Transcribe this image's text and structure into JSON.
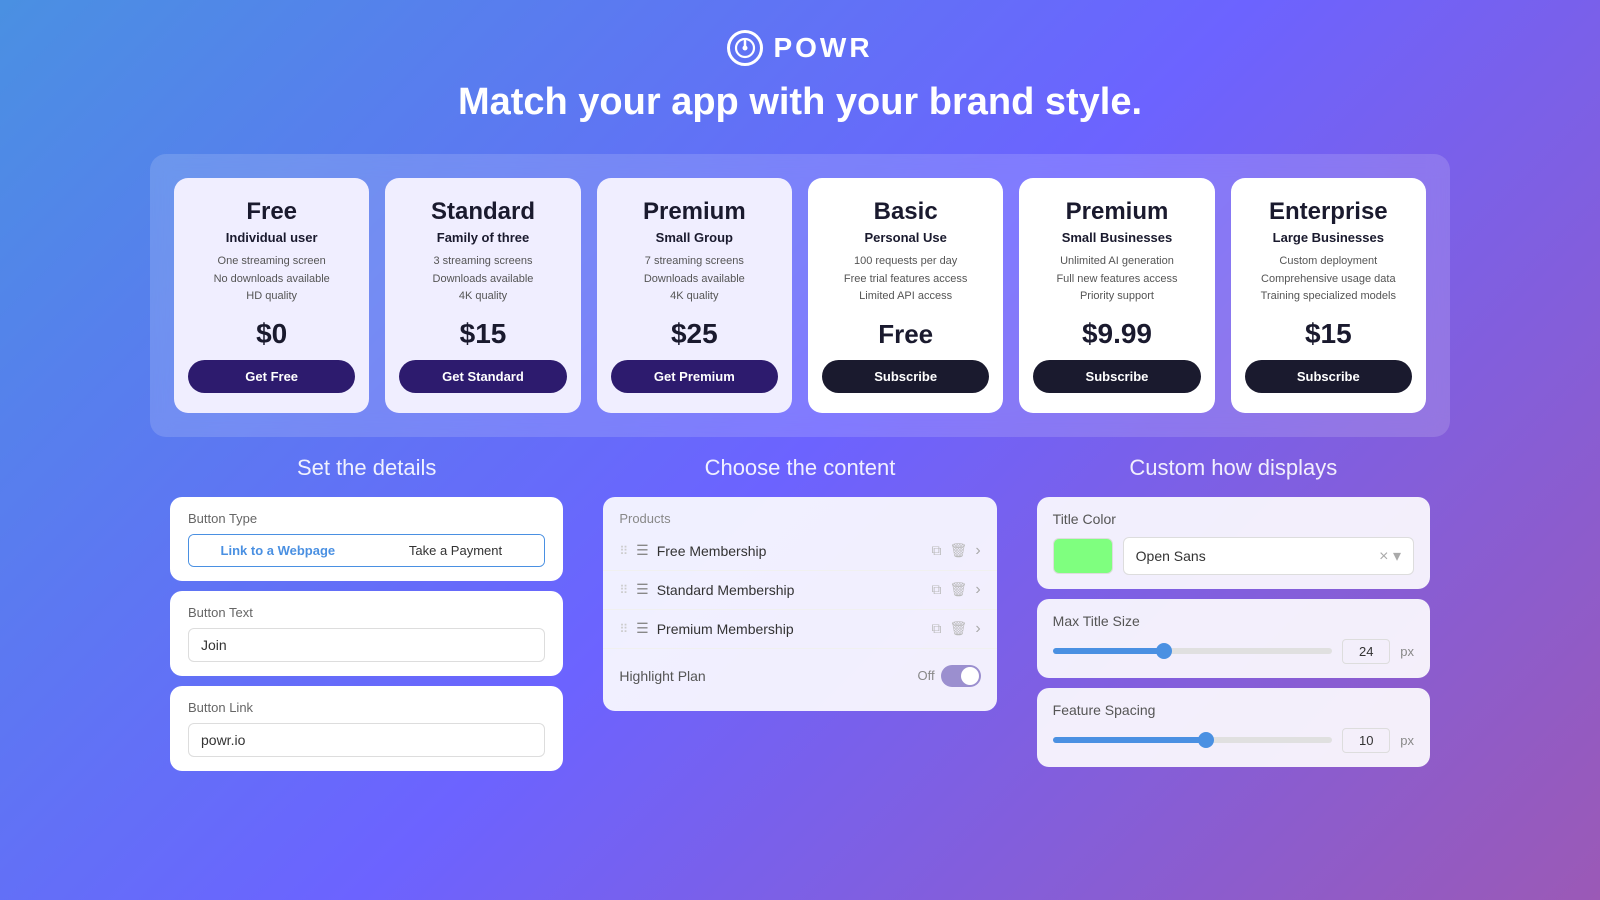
{
  "header": {
    "logo_text": "POWR",
    "tagline": "Match your app with your brand style."
  },
  "plans": [
    {
      "name": "Free",
      "subtitle": "Individual user",
      "features": [
        "One streaming screen",
        "No downloads available",
        "HD quality"
      ],
      "price": "$0",
      "btn_label": "Get Free",
      "tinted": true
    },
    {
      "name": "Standard",
      "subtitle": "Family of three",
      "features": [
        "3 streaming screens",
        "Downloads available",
        "4K quality"
      ],
      "price": "$15",
      "btn_label": "Get Standard",
      "tinted": true
    },
    {
      "name": "Premium",
      "subtitle": "Small Group",
      "features": [
        "7 streaming screens",
        "Downloads available",
        "4K quality"
      ],
      "price": "$25",
      "btn_label": "Get Premium",
      "tinted": true
    },
    {
      "name": "Basic",
      "subtitle": "Personal Use",
      "features": [
        "100 requests per day",
        "Free trial features access",
        "Limited API access"
      ],
      "price": "Free",
      "btn_label": "Subscribe",
      "tinted": false
    },
    {
      "name": "Premium",
      "subtitle": "Small Businesses",
      "features": [
        "Unlimited AI generation",
        "Full new features access",
        "Priority support"
      ],
      "price": "$9.99",
      "btn_label": "Subscribe",
      "tinted": false
    },
    {
      "name": "Enterprise",
      "subtitle": "Large Businesses",
      "features": [
        "Custom deployment",
        "Comprehensive usage data",
        "Training specialized models"
      ],
      "price": "$15",
      "btn_label": "Subscribe",
      "tinted": false
    }
  ],
  "sections": {
    "left_title": "Set the details",
    "middle_title": "Choose the content",
    "right_title": "Custom how displays"
  },
  "left": {
    "btn_type_label": "Button Type",
    "btn_type_options": [
      "Link to a Webpage",
      "Take a Payment"
    ],
    "btn_text_label": "Button Text",
    "btn_text_value": "Join",
    "btn_link_label": "Button Link",
    "btn_link_value": "powr.io"
  },
  "middle": {
    "products_label": "Products",
    "items": [
      "Free Membership",
      "Standard Membership",
      "Premium Membership"
    ],
    "highlight_label": "Highlight Plan",
    "toggle_off_label": "Off"
  },
  "right": {
    "title_color_label": "Title Color",
    "title_color_swatch": "#7fff7f",
    "font_value": "Open Sans",
    "font_close": "×",
    "max_title_label": "Max Title Size",
    "max_title_value": "24",
    "max_title_unit": "px",
    "max_title_fill_pct": "40",
    "max_title_thumb_pct": "40",
    "feature_spacing_label": "Feature Spacing",
    "feature_spacing_value": "10",
    "feature_spacing_unit": "px",
    "feature_spacing_fill_pct": "55",
    "feature_spacing_thumb_pct": "55"
  }
}
